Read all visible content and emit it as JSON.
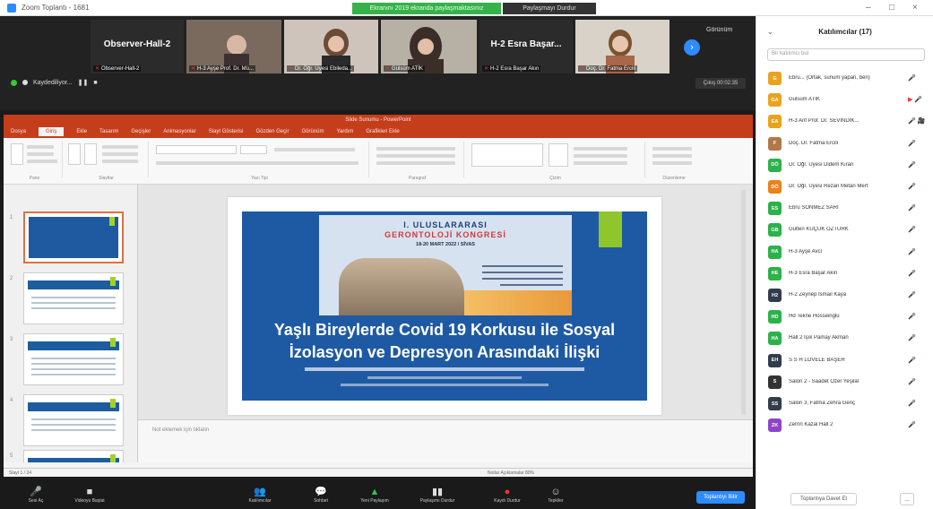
{
  "window": {
    "title": "Zoom Toplantı - 1681",
    "share_banner": "Ekranını 2019 ekranda paylaşmaktasınız",
    "stop_share": "Paylaşmayı Durdur",
    "controls": [
      "–",
      "□",
      "×"
    ]
  },
  "gallery": {
    "tiles": [
      {
        "big_name": "Observer-Hall-2",
        "label": "Observer-Hall-2",
        "muted": true
      },
      {
        "big_name": "",
        "label": "H-3 Ayşe Prof. Dr. Mü...",
        "muted": true
      },
      {
        "big_name": "",
        "label": "Dr. Öğr. Üyesi Ebileda...",
        "muted": true
      },
      {
        "big_name": "",
        "label": "Gülsüm ATİK",
        "muted": true
      },
      {
        "big_name": "H-2 Esra Başar...",
        "label": "H-2 Esra Başar Akın",
        "muted": true
      },
      {
        "big_name": "",
        "label": "Doç. Dr. Fatma Ercili",
        "muted": true
      }
    ],
    "next_icon": "chevron-right-icon",
    "view_label": "Görünüm",
    "recording_label": "Kaydediliyor...",
    "pause_label": "❚❚",
    "stop_label": "■",
    "exit_label": "Çıkış 00:02:35"
  },
  "ppt": {
    "title": "Slide Sunumu - PowerPoint",
    "tabs": [
      "Dosya",
      "Giriş",
      "Ekle",
      "Tasarım",
      "Geçişler",
      "Animasyonlar",
      "Slayt Gösterisi",
      "Gözden Geçir",
      "Görünüm",
      "Yardım",
      "Grafikleri Ekle"
    ],
    "ribbon_groups": [
      "Pano",
      "Slaytlar",
      "Yazı Tipi",
      "Paragraf",
      "Çizim",
      "Düzenleme"
    ],
    "slide_numbers": [
      "1",
      "2",
      "3",
      "4",
      "5"
    ],
    "slide": {
      "poster_line1": "I. ULUSLARARASI",
      "poster_line2": "GERONTOLOJİ KONGRESİ",
      "poster_line3": "18-20 MART 2022 / SİVAS",
      "title_line1": "Yaşlı Bireylerde Covid 19 Korkusu ile Sosyal",
      "title_line2": "İzolasyon ve Depresyon Arasındaki İlişki"
    },
    "notes_placeholder": "Not eklemek için tıklatın",
    "status_left": "Slayt 1 / 24",
    "status_right": "Notlar   Açıklamalar   80%"
  },
  "toolbar": {
    "items": [
      {
        "icon": "microphone-icon",
        "glyph": "🎤",
        "label": "Sesi Aç"
      },
      {
        "icon": "video-icon",
        "glyph": "■",
        "label": "Videoyu Başlat"
      },
      {
        "icon": "participants-icon",
        "glyph": "👥",
        "label": "Katılımcılar"
      },
      {
        "icon": "chat-icon",
        "glyph": "💬",
        "label": "Sohbet"
      },
      {
        "icon": "share-screen-icon",
        "glyph": "▲",
        "label": "Yeni Paylaşım"
      },
      {
        "icon": "pause-share-icon",
        "glyph": "▮▮",
        "label": "Paylaşımı Durdur"
      },
      {
        "icon": "record-icon",
        "glyph": "●",
        "label": "Kaydı Durdur"
      },
      {
        "icon": "reactions-icon",
        "glyph": "☺",
        "label": "Tepkiler"
      }
    ],
    "end_label": "Toplantıyı Bitir"
  },
  "panel": {
    "title": "Katılımcılar (17)",
    "search_placeholder": "Bir katılımcı bul",
    "participants": [
      {
        "initials": "G",
        "name": "Ebru... (Ortak, sunum yapan, ben)",
        "color": "#e8a320",
        "status": "🎤"
      },
      {
        "initials": "GA",
        "name": "Gülsüm ATİK",
        "color": "#e8a320",
        "status": "▶ 🎤"
      },
      {
        "initials": "EA",
        "name": "H-3 Arif Prof. Dr. SEVİNDİK...",
        "color": "#e8a320",
        "status": "🎤 🎥"
      },
      {
        "initials": "F",
        "name": "Doç. Dr. Fatma Ercili",
        "color": "#b07848",
        "status": "🎤"
      },
      {
        "initials": "DÖ",
        "name": "Dr. Öğr. Üyesi Didem Kıran",
        "color": "#2db14a",
        "status": "🎤"
      },
      {
        "initials": "DÖ",
        "name": "Dr. Öğr. Üyesi Rezan Metan Mert",
        "color": "#e8821a",
        "status": "🎤"
      },
      {
        "initials": "ES",
        "name": "Ebru SÖNMEZ SARI",
        "color": "#2db14a",
        "status": "🎤"
      },
      {
        "initials": "GB",
        "name": "Gülten KÜÇÜK ÖZTÜRK",
        "color": "#2db14a",
        "status": "🎤"
      },
      {
        "initials": "HA",
        "name": "H-3 Ayşe Avcı",
        "color": "#2db14a",
        "status": "🎤"
      },
      {
        "initials": "HE",
        "name": "H-3 Esra Başar Akın",
        "color": "#2db14a",
        "status": "🎤"
      },
      {
        "initials": "H2",
        "name": "H-2 Zeynep Ismail Kaya",
        "color": "#333c4a",
        "status": "🎤"
      },
      {
        "initials": "HD",
        "name": "Hd Tekne Hosseinglu",
        "color": "#2db14a",
        "status": "🎤"
      },
      {
        "initials": "HA",
        "name": "Hall 2 Işık Pamay Akman",
        "color": "#2db14a",
        "status": "🎤"
      },
      {
        "initials": "EH",
        "name": "S S H LOVELE BAŞER",
        "color": "#333c4a",
        "status": "🎤"
      },
      {
        "initials": "S",
        "name": "Salon 2 - Saadet Özer Yeşilal",
        "color": "#333",
        "status": "🎤"
      },
      {
        "initials": "SS",
        "name": "Salon 3, Fatma Zehra Genç",
        "color": "#333c4a",
        "status": "🎤"
      },
      {
        "initials": "ZK",
        "name": "Zerrin Kazal Hall 2",
        "color": "#8e44c8",
        "status": "🎤"
      }
    ],
    "invite_label": "Toplantıya Davet Et",
    "more_label": "..."
  }
}
